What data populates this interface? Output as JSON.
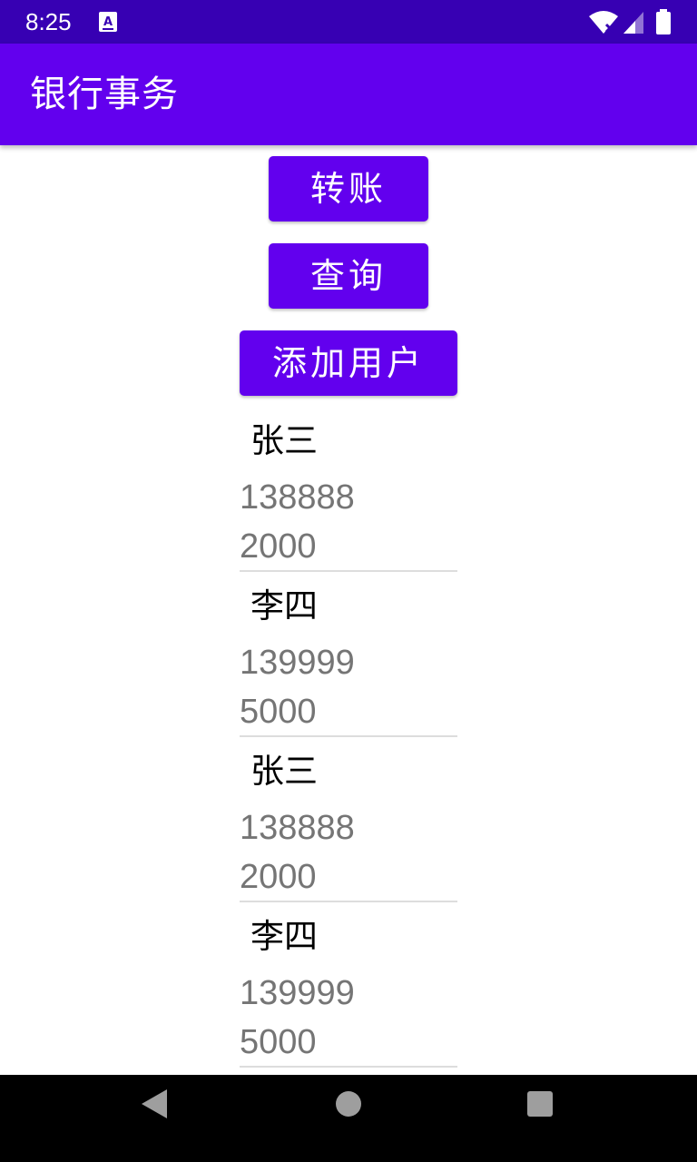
{
  "status_bar": {
    "time": "8:25",
    "icons": [
      "notification-a-icon",
      "wifi-icon",
      "signal-icon",
      "battery-icon"
    ]
  },
  "app_bar": {
    "title": "银行事务",
    "color": "#6200EE"
  },
  "buttons": {
    "transfer_label": "转账",
    "query_label": "查询",
    "add_user_label": "添加用户"
  },
  "users": [
    {
      "name": "张三",
      "phone": "138888",
      "balance": "2000"
    },
    {
      "name": "李四",
      "phone": "139999",
      "balance": "5000"
    },
    {
      "name": "张三",
      "phone": "138888",
      "balance": "2000"
    },
    {
      "name": "李四",
      "phone": "139999",
      "balance": "5000"
    }
  ],
  "nav_bar": {
    "icons": [
      "back-icon",
      "home-icon",
      "recents-icon"
    ]
  },
  "colors": {
    "status_bar": "#3700B3",
    "primary": "#6200EE",
    "secondary_text": "#757575"
  }
}
